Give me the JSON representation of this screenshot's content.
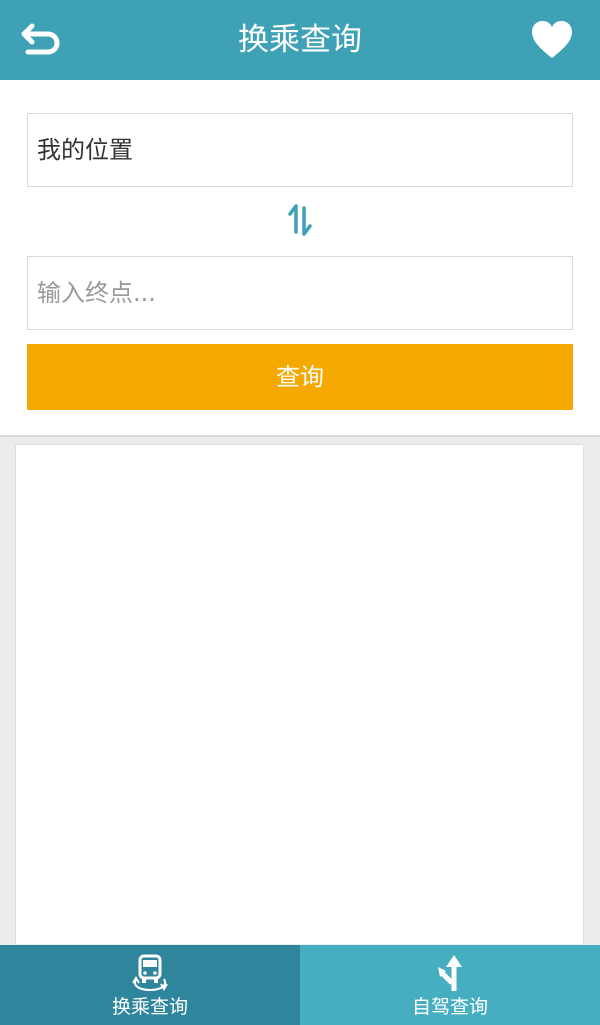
{
  "header": {
    "title": "换乘查询",
    "back_icon": "back-arrow-icon",
    "favorite_icon": "heart-icon"
  },
  "form": {
    "start_value": "我的位置",
    "end_placeholder": "输入终点...",
    "swap_icon": "swap-vertical-arrows-icon",
    "query_label": "查询"
  },
  "tabs": [
    {
      "label": "换乘查询",
      "icon": "bus-transfer-icon",
      "active": true
    },
    {
      "label": "自驾查询",
      "icon": "drive-route-icon",
      "active": false
    }
  ],
  "colors": {
    "header": "#3ea1b6",
    "query_button": "#f5a800",
    "tab_active": "#2f859c",
    "tab_inactive": "#47aec2",
    "swap_icon": "#3ea1b6"
  }
}
